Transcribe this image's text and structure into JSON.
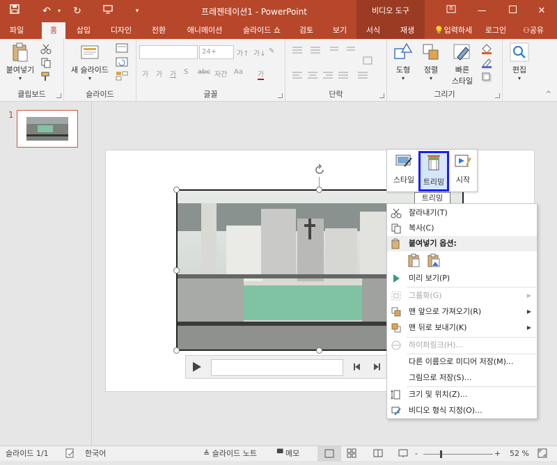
{
  "titlebar": {
    "title": "프레젠테이션1 - PowerPoint",
    "context_label": "비디오 도구",
    "qa_icons": [
      "save-icon",
      "undo-icon",
      "redo-icon",
      "presenter-icon",
      "customize-icon"
    ]
  },
  "tabs": [
    {
      "label": "파일"
    },
    {
      "label": "홈"
    },
    {
      "label": "삽입"
    },
    {
      "label": "디자인"
    },
    {
      "label": "전환"
    },
    {
      "label": "애니메이션"
    },
    {
      "label": "슬라이드 쇼"
    },
    {
      "label": "검토"
    },
    {
      "label": "보기"
    },
    {
      "label": "서식"
    },
    {
      "label": "재생"
    },
    {
      "label": "입력하세"
    },
    {
      "label": "로그인"
    },
    {
      "label": "공유"
    }
  ],
  "ribbon": {
    "clipboard": {
      "paste": "붙여넣기",
      "group": "클립보드"
    },
    "slides": {
      "new_slide": "새 슬라이드",
      "group": "슬라이드"
    },
    "font": {
      "size": "24+",
      "group": "글꼴"
    },
    "paragraph": {
      "group": "단락"
    },
    "drawing": {
      "shape": "도형",
      "arrange": "정렬",
      "quick_style_1": "빠른",
      "quick_style_2": "스타일",
      "group": "그리기"
    },
    "editing": {
      "label": "편집"
    }
  },
  "thumbnail": {
    "number": "1"
  },
  "minitoolbar": {
    "style": "스타일",
    "trim": "트리밍",
    "start": "시작"
  },
  "tooltip": "트리밍",
  "menu": {
    "cut": "잘라내기(T)",
    "copy": "복사(C)",
    "paste_options": "붙여넣기 옵션:",
    "preview": "미리 보기(P)",
    "group": "그룹화(G)",
    "bring_front": "맨 앞으로 가져오기(R)",
    "send_back": "맨 뒤로 보내기(K)",
    "hyperlink": "하이퍼링크(H)...",
    "save_media": "다른 이름으로 미디어 저장(M)...",
    "save_picture": "그림으로 저장(S)...",
    "size_position": "크기 및 위치(Z)...",
    "format_video": "비디오 형식 지정(O)..."
  },
  "statusbar": {
    "slide": "슬라이드 1/1",
    "lang": "한국어",
    "notes": "슬라이드 노트",
    "comments": "메모",
    "zoom": "52 %",
    "zoom_minus": "-",
    "zoom_plus": "+"
  },
  "colors": {
    "accent": "#b7472a",
    "highlight": "#1a1aff"
  }
}
